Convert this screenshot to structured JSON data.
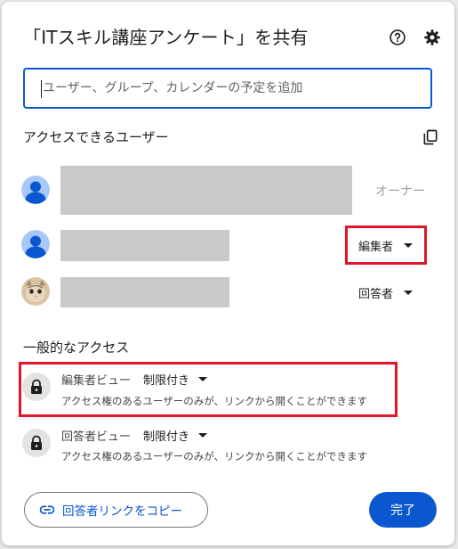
{
  "dialog": {
    "title": "「ITスキル講座アンケート」を共有",
    "help_icon": "help-circle-icon",
    "settings_icon": "gear-icon"
  },
  "search": {
    "placeholder": "ユーザー、グループ、カレンダーの予定を追加"
  },
  "people_section": {
    "title": "アクセスできるユーザー",
    "copy_icon": "copy-icon",
    "people": [
      {
        "avatar": "default-person-avatar",
        "role": "オーナー"
      },
      {
        "avatar": "default-person-avatar",
        "role": "編集者"
      },
      {
        "avatar": "cat-photo-avatar",
        "role": "回答者"
      }
    ]
  },
  "general_access": {
    "title": "一般的なアクセス",
    "items": [
      {
        "view_label": "編集者ビュー",
        "restriction": "制限付き",
        "description": "アクセス権のあるユーザーのみが、リンクから開くことができます"
      },
      {
        "view_label": "回答者ビュー",
        "restriction": "制限付き",
        "description": "アクセス権のあるユーザーのみが、リンクから開くことができます"
      }
    ]
  },
  "footer": {
    "copy_link_label": "回答者リンクをコピー",
    "done_label": "完了"
  },
  "colors": {
    "accent": "#0b57d0",
    "highlight": "#e0162b",
    "redaction": "#c9c9c9"
  }
}
